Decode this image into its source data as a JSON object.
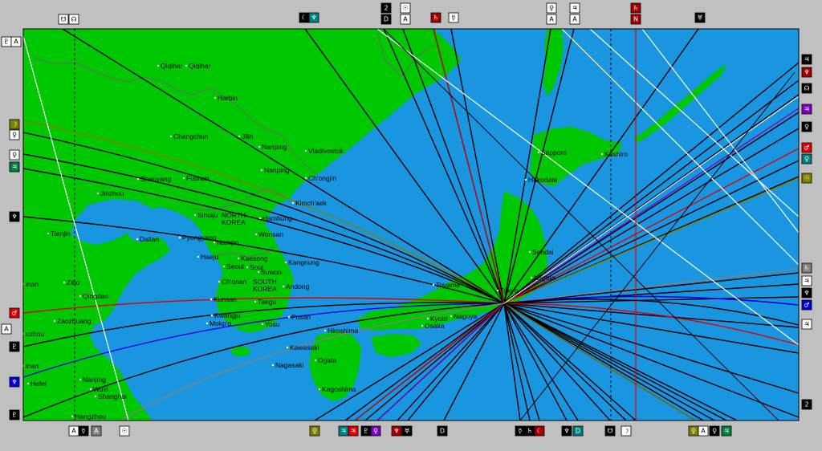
{
  "map": {
    "colors": {
      "ocean": "#1a96e0",
      "land": "#00c800",
      "frame": "#c0c0c0",
      "border": "#6a6a6a",
      "meridian": "#000000",
      "sun_line": "#808000",
      "moon_line": "#808080",
      "mars_line": "#e00000",
      "pluto_line": "#e00000",
      "venus_line": "#008080",
      "jupiter_line": "#8000c0",
      "neptune_line": "#0000e0",
      "white_line": "#ffffff",
      "dark_line": "#000000"
    },
    "cities": [
      {
        "name": "Qiqihar"
      },
      {
        "name": "Qiqihar"
      },
      {
        "name": "Harbin"
      },
      {
        "name": "Changchun"
      },
      {
        "name": "Jilin"
      },
      {
        "name": "Nanping"
      },
      {
        "name": "Vladivostok"
      },
      {
        "name": "Nanping"
      },
      {
        "name": "Shenyang"
      },
      {
        "name": "Fushun"
      },
      {
        "name": "Ch'ongjin"
      },
      {
        "name": "Jinzhou"
      },
      {
        "name": "Kimch'aek"
      },
      {
        "name": "Sinuiju"
      },
      {
        "name": "Hamhung"
      },
      {
        "name": "Tianjin"
      },
      {
        "name": "Dalian"
      },
      {
        "name": "Pyongyang"
      },
      {
        "name": "Nampo"
      },
      {
        "name": "Wonsan"
      },
      {
        "name": "Haeju"
      },
      {
        "name": "Kaesong"
      },
      {
        "name": "Kangnung"
      },
      {
        "name": "Seoul"
      },
      {
        "name": "Soul"
      },
      {
        "name": "Suwon"
      },
      {
        "name": "Zibo"
      },
      {
        "name": "inan"
      },
      {
        "name": "Ch'onan"
      },
      {
        "name": "Andong"
      },
      {
        "name": "Qingdao"
      },
      {
        "name": "Taegu"
      },
      {
        "name": "Kunsan"
      },
      {
        "name": "Pusan"
      },
      {
        "name": "Kwangju"
      },
      {
        "name": "Mokp'o"
      },
      {
        "name": "Yosu"
      },
      {
        "name": "Zaozhuang"
      },
      {
        "name": "uzhou"
      },
      {
        "name": "Hiroshima"
      },
      {
        "name": "Kawasaki"
      },
      {
        "name": "Nagasaki"
      },
      {
        "name": "Ogata"
      },
      {
        "name": "Kagoshima"
      },
      {
        "name": "Hefei"
      },
      {
        "name": "Nanjing"
      },
      {
        "name": "Wuxi"
      },
      {
        "name": "Shanghai"
      },
      {
        "name": "Hangzhou"
      },
      {
        "name": "inan"
      },
      {
        "name": "Sapporo"
      },
      {
        "name": "Kushiro"
      },
      {
        "name": "Hakodate"
      },
      {
        "name": "Sendai"
      },
      {
        "name": "Niigata"
      },
      {
        "name": "Nagoya"
      },
      {
        "name": "Kyoto"
      },
      {
        "name": "Osaka"
      },
      {
        "name": "Toyama"
      },
      {
        "name": "Tokyo"
      }
    ],
    "countries": [
      {
        "name": "NORTH"
      },
      {
        "name": "KOREA"
      },
      {
        "name": "SOUTH"
      },
      {
        "name": "KOREA"
      }
    ],
    "glyphs": {
      "top": [
        {
          "symbol": "☋"
        },
        {
          "symbol": "☊"
        },
        {
          "symbol": "☾"
        },
        {
          "symbol": "♆"
        },
        {
          "symbol": "2"
        },
        {
          "symbol": "☉"
        },
        {
          "symbol": "♄"
        },
        {
          "symbol": "☿"
        },
        {
          "symbol": "♀"
        },
        {
          "symbol": "♃"
        },
        {
          "symbol": "♄"
        },
        {
          "symbol": "♅"
        }
      ],
      "top_sub": [
        {
          "symbol": "D"
        },
        {
          "symbol": "A"
        },
        {
          "symbol": "A"
        },
        {
          "symbol": "A"
        },
        {
          "symbol": "N"
        }
      ],
      "left": [
        {
          "symbol": "♇"
        },
        {
          "symbol": "A"
        },
        {
          "symbol": "☽"
        },
        {
          "symbol": "♀"
        },
        {
          "symbol": "♀"
        },
        {
          "symbol": "♃"
        },
        {
          "symbol": "♆"
        },
        {
          "symbol": "♂"
        },
        {
          "symbol": "A"
        },
        {
          "symbol": "♇"
        },
        {
          "symbol": "♆"
        },
        {
          "symbol": "♇"
        }
      ],
      "right": [
        {
          "symbol": "♃"
        },
        {
          "symbol": "♆"
        },
        {
          "symbol": "☊"
        },
        {
          "symbol": "♃"
        },
        {
          "symbol": "♀"
        },
        {
          "symbol": "♂"
        },
        {
          "symbol": "♀"
        },
        {
          "symbol": "☉"
        },
        {
          "symbol": "♄"
        },
        {
          "symbol": "♃"
        },
        {
          "symbol": "♆"
        },
        {
          "symbol": "♂"
        },
        {
          "symbol": "♃"
        },
        {
          "symbol": "2"
        }
      ],
      "bottom": [
        {
          "symbol": "A"
        },
        {
          "symbol": "☿"
        },
        {
          "symbol": "A"
        },
        {
          "symbol": "☉"
        },
        {
          "symbol": "♀"
        },
        {
          "symbol": "♃"
        },
        {
          "symbol": "♃"
        },
        {
          "symbol": "♇"
        },
        {
          "symbol": "♀"
        },
        {
          "symbol": "♆"
        },
        {
          "symbol": "♅"
        },
        {
          "symbol": "D"
        },
        {
          "symbol": "☿"
        },
        {
          "symbol": "♄"
        },
        {
          "symbol": "☾"
        },
        {
          "symbol": "♆"
        },
        {
          "symbol": "D"
        },
        {
          "symbol": "☋"
        },
        {
          "symbol": "☽"
        },
        {
          "symbol": "♀"
        },
        {
          "symbol": "A"
        },
        {
          "symbol": "♀"
        },
        {
          "symbol": "♃"
        }
      ]
    }
  }
}
